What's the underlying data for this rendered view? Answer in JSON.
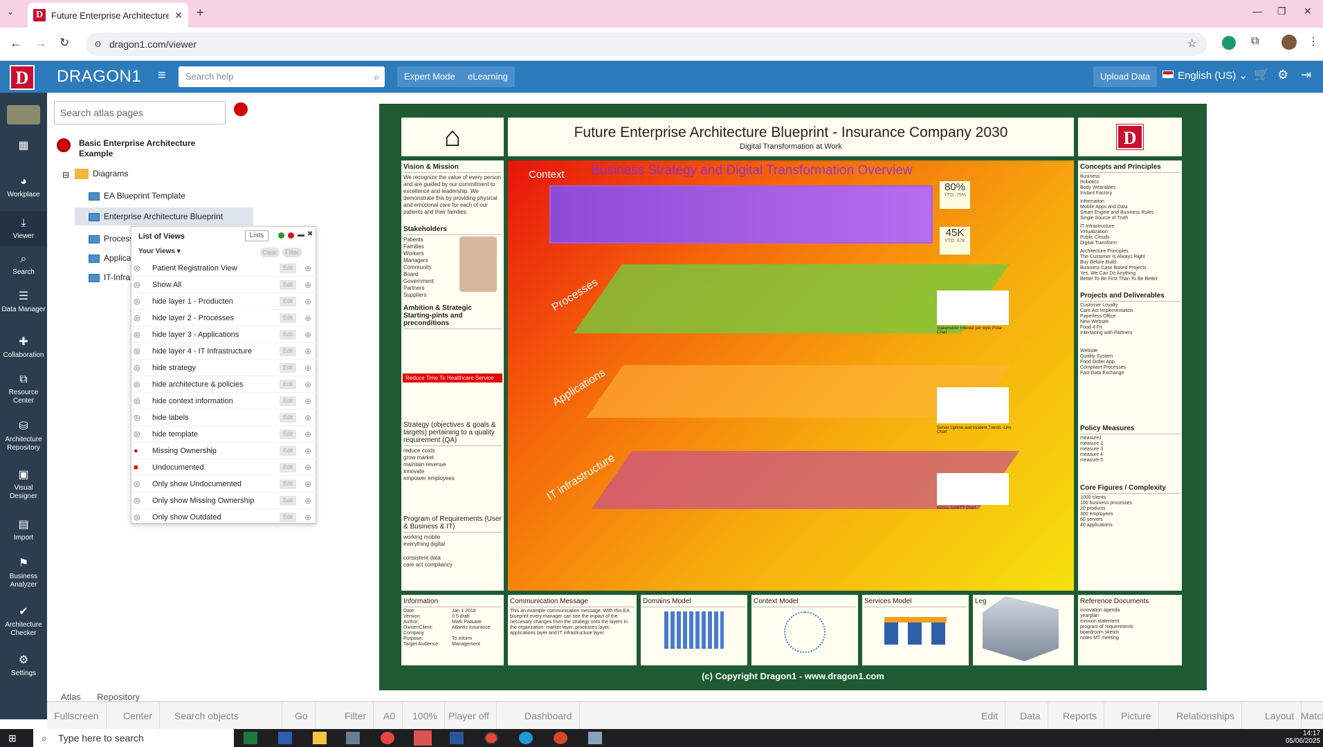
{
  "browser": {
    "tab_title": "Future Enterprise Architecture B",
    "url": "dragon1.com/viewer"
  },
  "header": {
    "brand": "DRAGON1",
    "logo_letter": "D",
    "search_placeholder": "Search help",
    "expert_mode": "Expert Mode",
    "elearning": "eLearning",
    "upload_data": "Upload Data",
    "language": "English (US)"
  },
  "sidebar": {
    "items": [
      {
        "label": "Workplace"
      },
      {
        "label": "Viewer"
      },
      {
        "label": "Search"
      },
      {
        "label": "Data Manager"
      },
      {
        "label": "Collaboration"
      },
      {
        "label": "Resource Center"
      },
      {
        "label": "Architecture Repository"
      },
      {
        "label": "Visual Designer"
      },
      {
        "label": "Import"
      },
      {
        "label": "Business Analyzer"
      },
      {
        "label": "Architecture Checker"
      },
      {
        "label": "Settings"
      }
    ]
  },
  "atlas": {
    "search_placeholder": "Search atlas pages",
    "root": "Basic Enterprise Architecture Example",
    "folder": "Diagrams",
    "items": [
      "EA Blueprint Template",
      "Enterprise Architecture Blueprint",
      "Process",
      "Applicat",
      "IT-Infras"
    ],
    "tabs": [
      "Atlas",
      "Repository"
    ]
  },
  "list_of_views": {
    "title": "List of Views",
    "lists_button": "Lists",
    "your_views": "Your Views",
    "clear": "Clear",
    "filter": "Filter",
    "edit_label": "Edit",
    "rows": [
      "Patient Registration View",
      "Show All",
      "hide layer 1 - Producten",
      "hide layer 2 - Processes",
      "hide layer 3 - Applications",
      "hide layer 4 - IT Infrastructure",
      "hide strategy",
      "hide architecture & policies",
      "hide context information",
      "hide labels",
      "hide template",
      "Missing Ownership",
      "Undocumented",
      "Only show Undocumented",
      "Only show Missing Ownership",
      "Only show Outdated"
    ]
  },
  "blueprint": {
    "title": "Future Enterprise Architecture Blueprint - Insurance Company 2030",
    "subtitle": "Digital Transformation at Work",
    "context_label": "Context",
    "overview_title": "Business Strategy and Digital Transformation Overview",
    "kpi1": "80%",
    "kpi1_sub": "YTD: 75%",
    "kpi2": "45K",
    "kpi2_sub": "YTD: 67K",
    "layer_processes": "Processes",
    "layer_applications": "Applications",
    "layer_it": "IT infrastructure",
    "left": {
      "vision_title": "Vision & Mission",
      "vision_text": "We recognize the value of every person and are guided by our commitment to excellence and leadership. We demonstrate this by providing physical and emotional care for each of our patients and their families.",
      "stakeholders_title": "Stakeholders",
      "stakeholders": [
        "Patients",
        "Families",
        "Workers",
        "Managers",
        "Community",
        "Board",
        "Government",
        "Partners",
        "Suppliers"
      ],
      "ambition_title": "Ambition & Strategic Starting-pints and preconditions",
      "ambition_bar": "Reduce Time To Healthcare Service",
      "strategy_title": "Strategy (objectives & goals & targets) pertaining to a quality requirement (QA)",
      "strategy_items": [
        "reduce costs",
        "grow market",
        "maintain revenue",
        "innovate",
        "empower employees"
      ],
      "program_title": "Program of Requirements (User & Business & IT)",
      "program_items": [
        "working mobile",
        "everything digital",
        "consistent data",
        "care act compliancy"
      ]
    },
    "right": {
      "concepts_title": "Concepts and Principles",
      "concepts_text": [
        "Business",
        "Robotics",
        "Body Wearables",
        "Instant Factory",
        "Information",
        "Mobile Apps and Data",
        "Smart Engine and Business Rules",
        "Single Source of Truth",
        "IT Infrastructure",
        "Virtualization",
        "Public Clouds",
        "Digital Transform",
        "Architecture Principles",
        "The Customer Is Always Right",
        "Buy Before Build",
        "Business Case Based Projects",
        "Yes, We Can Do Anything",
        "Better To Be First Than To Be Better"
      ],
      "projects_title": "Projects and Deliverables",
      "projects_items": [
        "Customer Loyalty",
        "Care Act Implementation",
        "Paperless Office",
        "New Website",
        "Food 4 Fit",
        "Interfacing with Partners",
        "Website",
        "Quality System",
        "Food Order App",
        "Compliant Processes",
        "Fast Data Exchange"
      ],
      "policy_title": "Policy Measures",
      "policy_items": [
        "measure1",
        "measure 2",
        "measure 3",
        "measure 4",
        "measure 5"
      ],
      "core_title": "Core Figures / Complexity",
      "core_items": [
        "1000 clients",
        "100 business processes",
        "20 products",
        "300 employees",
        "60 servers",
        "40 applications"
      ]
    },
    "bottom": {
      "information_title": "Information",
      "info_rows": [
        [
          "Date:",
          "Jan 1 2018"
        ],
        [
          "Version:",
          "0.5 draft"
        ],
        [
          "Author:",
          "Mark Paauwe"
        ],
        [
          "Owner/Client:",
          "Atlantis Insurance Company"
        ],
        [
          "Purpose:",
          "To Inform"
        ],
        [
          "Target Audience:",
          "Management"
        ]
      ],
      "comm_title": "Communication Message",
      "comm_text": "This an example communication message. With this EA blueprint every manager can see the impact of the neccesary changes from the strategy onto the layers in the organzation: market layer, processes layer, applications layer and IT infrastructure layer.",
      "domains_title": "Domains Model",
      "context_title": "Context Model",
      "services_title": "Services Model",
      "legend_title": "Leg",
      "refdocs_title": "Reference Documents",
      "refdocs_items": [
        "innovation agenda",
        "yearplan",
        "mission statement",
        "program of requirements",
        "boardroom sketch",
        "notes MT meeting"
      ]
    },
    "copyright": "(c) Copyright Dragon1 - www.dragon1.com",
    "side_chart1_label": "Stakeholder Interest per topic Polar Chart",
    "side_chart2_label": "Server Uptime and Incident Trends -Line Chart",
    "side_chart3_label": "techno GANTT Chart"
  },
  "bottom_toolbar": {
    "fullscreen": "Fullscreen",
    "center": "Center",
    "search_objects": "Search objects",
    "go": "Go",
    "filter": "Filter",
    "a0": "A0",
    "zoom": "100%",
    "player_off": "Player off",
    "dashboard": "Dashboard",
    "edit": "Edit",
    "data": "Data",
    "reports": "Reports",
    "picture": "Picture",
    "relationships": "Relationships",
    "layout": "Layout",
    "match": "Match"
  },
  "taskbar": {
    "search": "Type here to search",
    "time": "14:17",
    "date": "05/06/2025"
  },
  "colors": {
    "header_blue": "#2c7bbd",
    "sidebar_dark": "#2b3e4f",
    "dragon_red": "#c8102e",
    "board_green": "#1e5a32"
  }
}
